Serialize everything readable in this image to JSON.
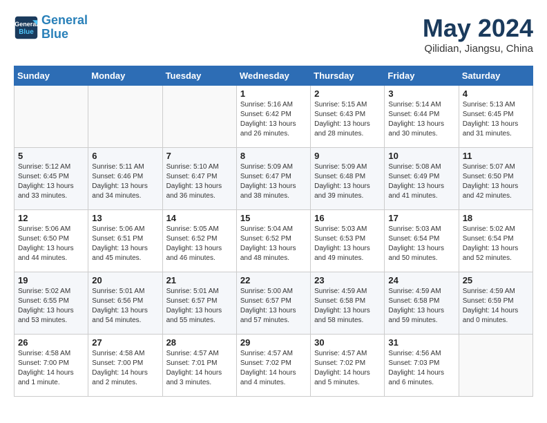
{
  "header": {
    "logo_line1": "General",
    "logo_line2": "Blue",
    "title": "May 2024",
    "subtitle": "Qilidian, Jiangsu, China"
  },
  "days_of_week": [
    "Sunday",
    "Monday",
    "Tuesday",
    "Wednesday",
    "Thursday",
    "Friday",
    "Saturday"
  ],
  "weeks": [
    [
      {
        "day": "",
        "info": ""
      },
      {
        "day": "",
        "info": ""
      },
      {
        "day": "",
        "info": ""
      },
      {
        "day": "1",
        "info": "Sunrise: 5:16 AM\nSunset: 6:42 PM\nDaylight: 13 hours\nand 26 minutes."
      },
      {
        "day": "2",
        "info": "Sunrise: 5:15 AM\nSunset: 6:43 PM\nDaylight: 13 hours\nand 28 minutes."
      },
      {
        "day": "3",
        "info": "Sunrise: 5:14 AM\nSunset: 6:44 PM\nDaylight: 13 hours\nand 30 minutes."
      },
      {
        "day": "4",
        "info": "Sunrise: 5:13 AM\nSunset: 6:45 PM\nDaylight: 13 hours\nand 31 minutes."
      }
    ],
    [
      {
        "day": "5",
        "info": "Sunrise: 5:12 AM\nSunset: 6:45 PM\nDaylight: 13 hours\nand 33 minutes."
      },
      {
        "day": "6",
        "info": "Sunrise: 5:11 AM\nSunset: 6:46 PM\nDaylight: 13 hours\nand 34 minutes."
      },
      {
        "day": "7",
        "info": "Sunrise: 5:10 AM\nSunset: 6:47 PM\nDaylight: 13 hours\nand 36 minutes."
      },
      {
        "day": "8",
        "info": "Sunrise: 5:09 AM\nSunset: 6:47 PM\nDaylight: 13 hours\nand 38 minutes."
      },
      {
        "day": "9",
        "info": "Sunrise: 5:09 AM\nSunset: 6:48 PM\nDaylight: 13 hours\nand 39 minutes."
      },
      {
        "day": "10",
        "info": "Sunrise: 5:08 AM\nSunset: 6:49 PM\nDaylight: 13 hours\nand 41 minutes."
      },
      {
        "day": "11",
        "info": "Sunrise: 5:07 AM\nSunset: 6:50 PM\nDaylight: 13 hours\nand 42 minutes."
      }
    ],
    [
      {
        "day": "12",
        "info": "Sunrise: 5:06 AM\nSunset: 6:50 PM\nDaylight: 13 hours\nand 44 minutes."
      },
      {
        "day": "13",
        "info": "Sunrise: 5:06 AM\nSunset: 6:51 PM\nDaylight: 13 hours\nand 45 minutes."
      },
      {
        "day": "14",
        "info": "Sunrise: 5:05 AM\nSunset: 6:52 PM\nDaylight: 13 hours\nand 46 minutes."
      },
      {
        "day": "15",
        "info": "Sunrise: 5:04 AM\nSunset: 6:52 PM\nDaylight: 13 hours\nand 48 minutes."
      },
      {
        "day": "16",
        "info": "Sunrise: 5:03 AM\nSunset: 6:53 PM\nDaylight: 13 hours\nand 49 minutes."
      },
      {
        "day": "17",
        "info": "Sunrise: 5:03 AM\nSunset: 6:54 PM\nDaylight: 13 hours\nand 50 minutes."
      },
      {
        "day": "18",
        "info": "Sunrise: 5:02 AM\nSunset: 6:54 PM\nDaylight: 13 hours\nand 52 minutes."
      }
    ],
    [
      {
        "day": "19",
        "info": "Sunrise: 5:02 AM\nSunset: 6:55 PM\nDaylight: 13 hours\nand 53 minutes."
      },
      {
        "day": "20",
        "info": "Sunrise: 5:01 AM\nSunset: 6:56 PM\nDaylight: 13 hours\nand 54 minutes."
      },
      {
        "day": "21",
        "info": "Sunrise: 5:01 AM\nSunset: 6:57 PM\nDaylight: 13 hours\nand 55 minutes."
      },
      {
        "day": "22",
        "info": "Sunrise: 5:00 AM\nSunset: 6:57 PM\nDaylight: 13 hours\nand 57 minutes."
      },
      {
        "day": "23",
        "info": "Sunrise: 4:59 AM\nSunset: 6:58 PM\nDaylight: 13 hours\nand 58 minutes."
      },
      {
        "day": "24",
        "info": "Sunrise: 4:59 AM\nSunset: 6:58 PM\nDaylight: 13 hours\nand 59 minutes."
      },
      {
        "day": "25",
        "info": "Sunrise: 4:59 AM\nSunset: 6:59 PM\nDaylight: 14 hours\nand 0 minutes."
      }
    ],
    [
      {
        "day": "26",
        "info": "Sunrise: 4:58 AM\nSunset: 7:00 PM\nDaylight: 14 hours\nand 1 minute."
      },
      {
        "day": "27",
        "info": "Sunrise: 4:58 AM\nSunset: 7:00 PM\nDaylight: 14 hours\nand 2 minutes."
      },
      {
        "day": "28",
        "info": "Sunrise: 4:57 AM\nSunset: 7:01 PM\nDaylight: 14 hours\nand 3 minutes."
      },
      {
        "day": "29",
        "info": "Sunrise: 4:57 AM\nSunset: 7:02 PM\nDaylight: 14 hours\nand 4 minutes."
      },
      {
        "day": "30",
        "info": "Sunrise: 4:57 AM\nSunset: 7:02 PM\nDaylight: 14 hours\nand 5 minutes."
      },
      {
        "day": "31",
        "info": "Sunrise: 4:56 AM\nSunset: 7:03 PM\nDaylight: 14 hours\nand 6 minutes."
      },
      {
        "day": "",
        "info": ""
      }
    ]
  ]
}
